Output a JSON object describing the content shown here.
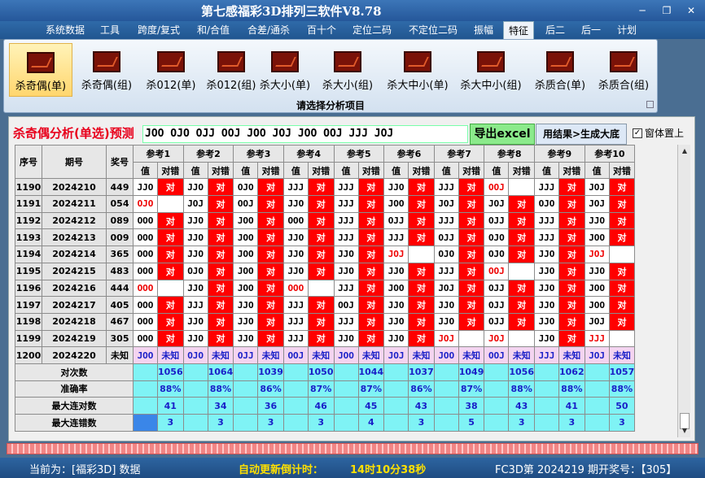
{
  "window": {
    "title": "第七感福彩3D排列三软件V8.78",
    "minimize": "─",
    "maximize": "❐",
    "close": "✕"
  },
  "menu": [
    "系统数据",
    "工具",
    "跨度/复式",
    "和/合值",
    "合差/通杀",
    "百十个",
    "定位二码",
    "不定位二码",
    "振幅",
    "特征",
    "后二",
    "后一",
    "计划"
  ],
  "menu_active": "特征",
  "ribbon": {
    "buttons": [
      "杀奇偶(单)",
      "杀奇偶(组)",
      "杀012(单)",
      "杀012(组)",
      "杀大小(单)",
      "杀大小(组)",
      "杀大中小(单)",
      "杀大中小(组)",
      "杀质合(单)",
      "杀质合(组)"
    ],
    "active_index": 0,
    "icon": "chart-icon",
    "caption": "请选择分析项目"
  },
  "panel": {
    "heading": "杀奇偶分析(单选)预测",
    "pattern_input": "JOO OJO OJJ OOJ JOO JOJ JOO OOJ JJJ JOJ",
    "export_button": "导出excel",
    "generate_button": "用结果>生成大底",
    "ontop_checked": "✓",
    "ontop_label": "窗体置上"
  },
  "table": {
    "headers": {
      "seq": "序号",
      "period": "期号",
      "prize": "奖号",
      "value": "值",
      "hit": "对错"
    },
    "refs": [
      "参考1",
      "参考2",
      "参考3",
      "参考4",
      "参考5",
      "参考6",
      "参考7",
      "参考8",
      "参考9",
      "参考10"
    ],
    "hit_text": "对",
    "rows": [
      {
        "seq": "1190",
        "period": "2024210",
        "prize": "449",
        "cells": [
          [
            "JJO",
            "1"
          ],
          [
            "JJO",
            "1"
          ],
          [
            "OJO",
            "1"
          ],
          [
            "JJJ",
            "1"
          ],
          [
            "JJJ",
            "1"
          ],
          [
            "JJO",
            "1"
          ],
          [
            "JJJ",
            "1"
          ],
          [
            "OOJ",
            "0"
          ],
          [
            "JJJ",
            "1"
          ],
          [
            "JOJ",
            "1"
          ]
        ]
      },
      {
        "seq": "1191",
        "period": "2024211",
        "prize": "054",
        "cells": [
          [
            "OJO",
            "0"
          ],
          [
            "JOJ",
            "1"
          ],
          [
            "OOJ",
            "1"
          ],
          [
            "JJO",
            "1"
          ],
          [
            "JJJ",
            "1"
          ],
          [
            "JOO",
            "1"
          ],
          [
            "JOJ",
            "1"
          ],
          [
            "JOJ",
            "1"
          ],
          [
            "OJO",
            "1"
          ],
          [
            "JOJ",
            "1"
          ]
        ]
      },
      {
        "seq": "1192",
        "period": "2024212",
        "prize": "089",
        "cells": [
          [
            "OOO",
            "1"
          ],
          [
            "JJO",
            "1"
          ],
          [
            "JOO",
            "1"
          ],
          [
            "OOO",
            "1"
          ],
          [
            "JJJ",
            "1"
          ],
          [
            "OJJ",
            "1"
          ],
          [
            "JJJ",
            "1"
          ],
          [
            "OJJ",
            "1"
          ],
          [
            "JJJ",
            "1"
          ],
          [
            "JJO",
            "1"
          ]
        ]
      },
      {
        "seq": "1193",
        "period": "2024213",
        "prize": "009",
        "cells": [
          [
            "OOO",
            "1"
          ],
          [
            "JJO",
            "1"
          ],
          [
            "JOO",
            "1"
          ],
          [
            "JJO",
            "1"
          ],
          [
            "JJJ",
            "1"
          ],
          [
            "JJJ",
            "1"
          ],
          [
            "OJJ",
            "1"
          ],
          [
            "OJO",
            "1"
          ],
          [
            "JJJ",
            "1"
          ],
          [
            "JOO",
            "1"
          ]
        ]
      },
      {
        "seq": "1194",
        "period": "2024214",
        "prize": "365",
        "cells": [
          [
            "OOO",
            "1"
          ],
          [
            "JJO",
            "1"
          ],
          [
            "JOO",
            "1"
          ],
          [
            "JJO",
            "1"
          ],
          [
            "JJO",
            "1"
          ],
          [
            "JOJ",
            "0"
          ],
          [
            "OJO",
            "1"
          ],
          [
            "OJO",
            "1"
          ],
          [
            "JJO",
            "1"
          ],
          [
            "JOJ",
            "0"
          ]
        ]
      },
      {
        "seq": "1195",
        "period": "2024215",
        "prize": "483",
        "cells": [
          [
            "OOO",
            "1"
          ],
          [
            "OJO",
            "1"
          ],
          [
            "JOO",
            "1"
          ],
          [
            "JJO",
            "1"
          ],
          [
            "JJO",
            "1"
          ],
          [
            "JJO",
            "1"
          ],
          [
            "JJJ",
            "1"
          ],
          [
            "OOJ",
            "0"
          ],
          [
            "JJO",
            "1"
          ],
          [
            "JJO",
            "1"
          ]
        ]
      },
      {
        "seq": "1196",
        "period": "2024216",
        "prize": "444",
        "cells": [
          [
            "OOO",
            "0"
          ],
          [
            "JJO",
            "1"
          ],
          [
            "JOO",
            "1"
          ],
          [
            "OOO",
            "0"
          ],
          [
            "JJJ",
            "1"
          ],
          [
            "JOO",
            "1"
          ],
          [
            "JOJ",
            "1"
          ],
          [
            "OJJ",
            "1"
          ],
          [
            "JJO",
            "1"
          ],
          [
            "JOO",
            "1"
          ]
        ]
      },
      {
        "seq": "1197",
        "period": "2024217",
        "prize": "405",
        "cells": [
          [
            "OOO",
            "1"
          ],
          [
            "JJJ",
            "1"
          ],
          [
            "JJO",
            "1"
          ],
          [
            "JJJ",
            "1"
          ],
          [
            "OOJ",
            "1"
          ],
          [
            "JJO",
            "1"
          ],
          [
            "JJO",
            "1"
          ],
          [
            "OJJ",
            "1"
          ],
          [
            "JJO",
            "1"
          ],
          [
            "JOO",
            "1"
          ]
        ]
      },
      {
        "seq": "1198",
        "period": "2024218",
        "prize": "467",
        "cells": [
          [
            "OOO",
            "1"
          ],
          [
            "JJO",
            "1"
          ],
          [
            "JJO",
            "1"
          ],
          [
            "JJJ",
            "1"
          ],
          [
            "JJJ",
            "1"
          ],
          [
            "JJO",
            "1"
          ],
          [
            "JJO",
            "1"
          ],
          [
            "OJJ",
            "1"
          ],
          [
            "JJO",
            "1"
          ],
          [
            "JOJ",
            "1"
          ]
        ]
      },
      {
        "seq": "1199",
        "period": "2024219",
        "prize": "305",
        "cells": [
          [
            "OOO",
            "1"
          ],
          [
            "JJO",
            "1"
          ],
          [
            "JJO",
            "1"
          ],
          [
            "JJJ",
            "1"
          ],
          [
            "JJO",
            "1"
          ],
          [
            "JJO",
            "1"
          ],
          [
            "JOJ",
            "0"
          ],
          [
            "JOJ",
            "0"
          ],
          [
            "JJO",
            "1"
          ],
          [
            "JJJ",
            "0"
          ]
        ]
      }
    ],
    "prediction": {
      "seq": "1200",
      "period": "2024220",
      "prize": "未知",
      "unknown": "未知",
      "values": [
        "JOO",
        "OJO",
        "OJJ",
        "OOJ",
        "JOO",
        "JOJ",
        "JOO",
        "OOJ",
        "JJJ",
        "JOJ"
      ]
    },
    "stats": [
      {
        "label": "对次数",
        "values": [
          "1056",
          "1064",
          "1039",
          "1050",
          "1044",
          "1037",
          "1049",
          "1056",
          "1062",
          "1057"
        ]
      },
      {
        "label": "准确率",
        "values": [
          "88%",
          "88%",
          "86%",
          "87%",
          "87%",
          "86%",
          "87%",
          "88%",
          "88%",
          "88%"
        ]
      },
      {
        "label": "最大连对数",
        "values": [
          "41",
          "34",
          "36",
          "46",
          "45",
          "43",
          "38",
          "43",
          "41",
          "50"
        ]
      },
      {
        "label": "最大连错数",
        "values": [
          "3",
          "3",
          "3",
          "3",
          "4",
          "3",
          "5",
          "3",
          "3",
          "3"
        ]
      }
    ]
  },
  "status": {
    "source": "当前为：[福彩3D] 数据",
    "countdown_label": "自动更新倒计时：",
    "countdown": "14时10分38秒",
    "draw": "FC3D第 2024219 期开奖号：【305】"
  }
}
